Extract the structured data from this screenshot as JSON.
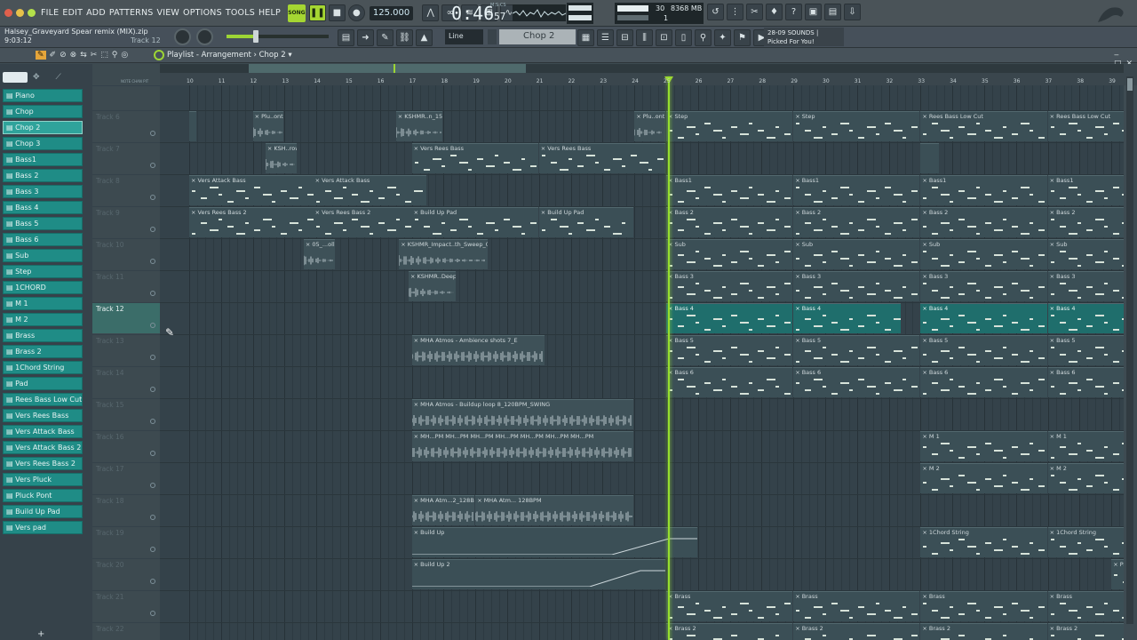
{
  "menus": [
    "FILE",
    "EDIT",
    "ADD",
    "PATTERNS",
    "VIEW",
    "OPTIONS",
    "TOOLS",
    "HELP"
  ],
  "transport": {
    "song_label": "SONG",
    "tempo": "125.000",
    "time_main": "0:46",
    "time_sub": "57",
    "time_unit": "M:S:CS"
  },
  "cpu": {
    "cpu_value": "30",
    "mem": "8368 MB",
    "poly": "1"
  },
  "project": {
    "file": "Halsey_Graveyard Spear remix (MIX).zip",
    "elapsed": "9:03:12",
    "track_hint": "Track 12"
  },
  "snap": {
    "value": "Line"
  },
  "pattern": {
    "name": "Chop 2"
  },
  "news": {
    "date": "28-09",
    "headline": "SOUNDS |",
    "sub": "Picked For You!"
  },
  "playlist": {
    "title": "Playlist - Arrangement",
    "pattern": "Chop 2"
  },
  "browser_plus": "+",
  "channels": [
    "Piano",
    "Chop",
    "Chop 2",
    "Chop 3",
    "Bass1",
    "Bass 2",
    "Bass 3",
    "Bass 4",
    "Bass 5",
    "Bass 6",
    "Sub",
    "Step",
    "1CHORD",
    "M 1",
    "M 2",
    "Brass",
    "Brass 2",
    "1Chord String",
    "Pad",
    "Rees Bass Low Cut",
    "Vers Rees Bass",
    "Vers Attack Bass",
    "Vers Attack Bass 2",
    "Vers Rees Bass 2",
    "Vers Pluck",
    "Pluck Pont",
    "Build Up Pad",
    "Vers pad"
  ],
  "selected_channel": 2,
  "col_header": "NOTE  CHAN  PIT",
  "bars": [
    "10",
    "11",
    "12",
    "13",
    "14",
    "15",
    "16",
    "17",
    "18",
    "19",
    "20",
    "21",
    "22",
    "23",
    "24",
    "25",
    "26",
    "27",
    "28",
    "29",
    "30",
    "31",
    "32",
    "33",
    "34",
    "35",
    "36",
    "37",
    "38",
    "39"
  ],
  "tracks": [
    "Track 6",
    "Track 7",
    "Track 8",
    "Track 9",
    "Track 10",
    "Track 11",
    "Track 12",
    "Track 13",
    "Track 14",
    "Track 15",
    "Track 16",
    "Track 17",
    "Track 18",
    "Track 19",
    "Track 20",
    "Track 21",
    "Track 22"
  ],
  "selected_track": "Track 12",
  "clips": [
    {
      "t": 0,
      "b": 10.0,
      "l": 0.0,
      "name": ""
    },
    {
      "t": 0,
      "b": 12.0,
      "l": 1.0,
      "name": "Plu..ont"
    },
    {
      "t": 0,
      "b": 16.5,
      "l": 1.5,
      "name": "KSHMR..n_15"
    },
    {
      "t": 0,
      "b": 24.0,
      "l": 1.0,
      "name": "Plu..ont"
    },
    {
      "t": 0,
      "b": 25.0,
      "l": 4.0,
      "name": "Step"
    },
    {
      "t": 0,
      "b": 29.0,
      "l": 4.0,
      "name": "Step"
    },
    {
      "t": 0,
      "b": 33.0,
      "l": 4.0,
      "name": "Rees Bass Low Cut"
    },
    {
      "t": 0,
      "b": 37.0,
      "l": 2.7,
      "name": "Rees Bass Low Cut"
    },
    {
      "t": 1,
      "b": 12.4,
      "l": 1.0,
      "name": "KSH..rowl"
    },
    {
      "t": 1,
      "b": 17.0,
      "l": 4.0,
      "name": "Vers Rees Bass"
    },
    {
      "t": 1,
      "b": 21.0,
      "l": 4.0,
      "name": "Vers Rees Bass"
    },
    {
      "t": 1,
      "b": 33.0,
      "l": 0.6,
      "name": ""
    },
    {
      "t": 2,
      "b": 10.0,
      "l": 4.0,
      "name": "Vers Attack Bass"
    },
    {
      "t": 2,
      "b": 13.9,
      "l": 3.6,
      "name": "Vers Attack Bass"
    },
    {
      "t": 2,
      "b": 25.0,
      "l": 4.0,
      "name": "Bass1"
    },
    {
      "t": 2,
      "b": 29.0,
      "l": 4.0,
      "name": "Bass1"
    },
    {
      "t": 2,
      "b": 33.0,
      "l": 4.0,
      "name": "Bass1"
    },
    {
      "t": 2,
      "b": 37.0,
      "l": 2.7,
      "name": "Bass1"
    },
    {
      "t": 3,
      "b": 10.0,
      "l": 4.0,
      "name": "Vers Rees Bass 2"
    },
    {
      "t": 3,
      "b": 13.9,
      "l": 3.6,
      "name": "Vers Rees Bass 2"
    },
    {
      "t": 3,
      "b": 17.0,
      "l": 4.0,
      "name": "Build Up Pad"
    },
    {
      "t": 3,
      "b": 21.0,
      "l": 3.0,
      "name": "Build Up Pad"
    },
    {
      "t": 3,
      "b": 25.0,
      "l": 4.0,
      "name": "Bass 2"
    },
    {
      "t": 3,
      "b": 29.0,
      "l": 4.0,
      "name": "Bass 2"
    },
    {
      "t": 3,
      "b": 33.0,
      "l": 4.0,
      "name": "Bass 2"
    },
    {
      "t": 3,
      "b": 37.0,
      "l": 2.7,
      "name": "Bass 2"
    },
    {
      "t": 4,
      "b": 13.6,
      "l": 1.0,
      "name": "05_...oll"
    },
    {
      "t": 4,
      "b": 16.6,
      "l": 2.8,
      "name": "KSHMR_Impact..th_Sweep_03"
    },
    {
      "t": 4,
      "b": 25.0,
      "l": 4.0,
      "name": "Sub"
    },
    {
      "t": 4,
      "b": 29.0,
      "l": 4.0,
      "name": "Sub"
    },
    {
      "t": 4,
      "b": 33.0,
      "l": 4.0,
      "name": "Sub"
    },
    {
      "t": 4,
      "b": 37.0,
      "l": 2.7,
      "name": "Sub"
    },
    {
      "t": 5,
      "b": 16.9,
      "l": 1.5,
      "name": "KSHMR..Deep"
    },
    {
      "t": 5,
      "b": 25.0,
      "l": 4.0,
      "name": "Bass 3"
    },
    {
      "t": 5,
      "b": 29.0,
      "l": 4.0,
      "name": "Bass 3"
    },
    {
      "t": 5,
      "b": 33.0,
      "l": 4.0,
      "name": "Bass 3"
    },
    {
      "t": 5,
      "b": 37.0,
      "l": 2.7,
      "name": "Bass 3"
    },
    {
      "t": 6,
      "b": 25.0,
      "l": 4.0,
      "name": "Bass 4"
    },
    {
      "t": 6,
      "b": 29.0,
      "l": 3.4,
      "name": "Bass 4"
    },
    {
      "t": 6,
      "b": 33.0,
      "l": 4.0,
      "name": "Bass 4"
    },
    {
      "t": 6,
      "b": 37.0,
      "l": 2.7,
      "name": "Bass 4"
    },
    {
      "t": 7,
      "b": 17.0,
      "l": 4.2,
      "name": "MHA Atmos - Ambience shots 7_E"
    },
    {
      "t": 7,
      "b": 25.0,
      "l": 4.0,
      "name": "Bass 5"
    },
    {
      "t": 7,
      "b": 29.0,
      "l": 4.0,
      "name": "Bass 5"
    },
    {
      "t": 7,
      "b": 33.0,
      "l": 4.0,
      "name": "Bass 5"
    },
    {
      "t": 7,
      "b": 37.0,
      "l": 2.7,
      "name": "Bass 5"
    },
    {
      "t": 8,
      "b": 25.0,
      "l": 4.0,
      "name": "Bass 6"
    },
    {
      "t": 8,
      "b": 29.0,
      "l": 4.0,
      "name": "Bass 6"
    },
    {
      "t": 8,
      "b": 33.0,
      "l": 4.0,
      "name": "Bass 6"
    },
    {
      "t": 8,
      "b": 37.0,
      "l": 2.7,
      "name": "Bass 6"
    },
    {
      "t": 9,
      "b": 17.0,
      "l": 7.0,
      "name": "MHA Atmos - Buildup loop 8_120BPM_SWING"
    },
    {
      "t": 10,
      "b": 17.0,
      "l": 7.0,
      "name": "MH...PM  MH...PM  MH...PM  MH...PM  MH...PM  MH...PM  MH...PM"
    },
    {
      "t": 10,
      "b": 33.0,
      "l": 4.0,
      "name": "M 1"
    },
    {
      "t": 10,
      "b": 37.0,
      "l": 2.7,
      "name": "M 1"
    },
    {
      "t": 11,
      "b": 33.0,
      "l": 4.0,
      "name": "M 2"
    },
    {
      "t": 11,
      "b": 37.0,
      "l": 2.7,
      "name": "M 2"
    },
    {
      "t": 12,
      "b": 17.0,
      "l": 2.0,
      "name": "MHA Atm...2_128BPM"
    },
    {
      "t": 12,
      "b": 19.0,
      "l": 5.0,
      "name": "MHA Atm... 128BPM"
    },
    {
      "t": 13,
      "b": 17.0,
      "l": 9.0,
      "name": "Build Up"
    },
    {
      "t": 13,
      "b": 33.0,
      "l": 4.0,
      "name": "1Chord String"
    },
    {
      "t": 13,
      "b": 37.0,
      "l": 2.7,
      "name": "1Chord String"
    },
    {
      "t": 14,
      "b": 17.0,
      "l": 8.0,
      "name": "Build Up 2"
    },
    {
      "t": 14,
      "b": 39.0,
      "l": 0.7,
      "name": "Pa..q"
    },
    {
      "t": 15,
      "b": 25.0,
      "l": 4.0,
      "name": "Brass"
    },
    {
      "t": 15,
      "b": 29.0,
      "l": 4.0,
      "name": "Brass"
    },
    {
      "t": 15,
      "b": 33.0,
      "l": 4.0,
      "name": "Brass"
    },
    {
      "t": 15,
      "b": 37.0,
      "l": 2.7,
      "name": "Brass"
    },
    {
      "t": 16,
      "b": 25.0,
      "l": 4.0,
      "name": "Brass 2"
    },
    {
      "t": 16,
      "b": 29.0,
      "l": 4.0,
      "name": "Brass 2"
    },
    {
      "t": 16,
      "b": 33.0,
      "l": 4.0,
      "name": "Brass 2"
    },
    {
      "t": 16,
      "b": 37.0,
      "l": 2.7,
      "name": "Brass 2"
    }
  ]
}
